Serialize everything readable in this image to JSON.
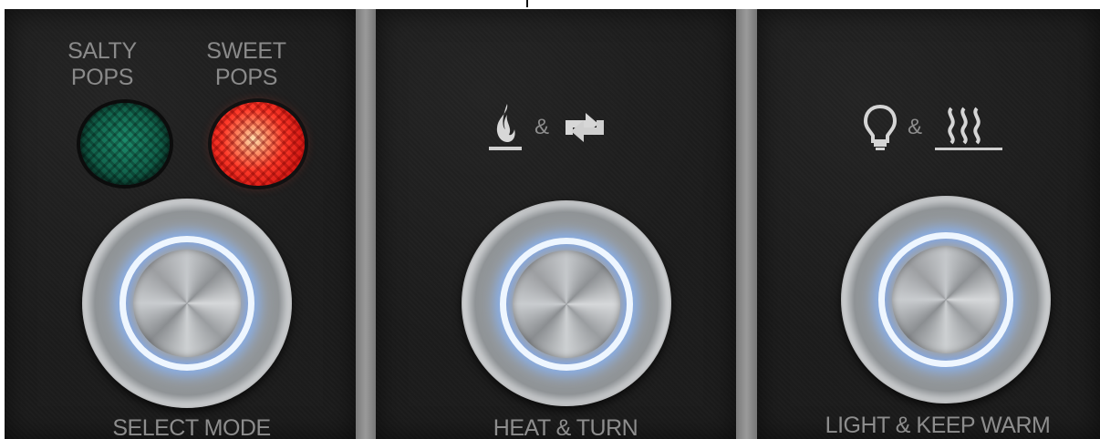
{
  "panels": {
    "select_mode": {
      "indicators": [
        {
          "label_line1": "SALTY",
          "label_line2": "POPS",
          "lamp_color": "#1d8b6b",
          "lit": false
        },
        {
          "label_line1": "SWEET",
          "label_line2": "POPS",
          "lamp_color": "#ff3b2a",
          "lit": true
        }
      ],
      "button_label": "SELECT MODE",
      "button_icon": "illuminated-push-button"
    },
    "heat_turn": {
      "icon_left": "flame-icon",
      "ampersand": "&",
      "icon_right": "rotate-arrows-icon",
      "button_label": "HEAT & TURN",
      "button_icon": "illuminated-push-button"
    },
    "light_keep_warm": {
      "icon_left": "light-bulb-icon",
      "ampersand": "&",
      "icon_right": "heat-waves-icon",
      "button_label": "LIGHT & KEEP WARM",
      "button_icon": "illuminated-push-button"
    }
  },
  "colors": {
    "panel": "#1c1c1c",
    "divider": "#8c8c8c",
    "label": "#8d8d8d",
    "button_glow": "#82b4ff"
  }
}
